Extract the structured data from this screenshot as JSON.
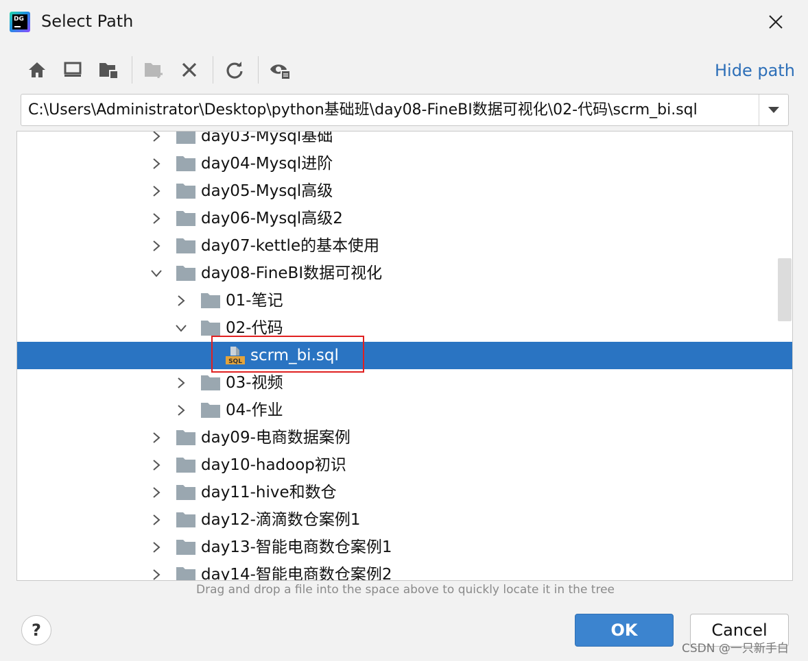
{
  "window": {
    "title": "Select Path",
    "app_icon_text": "DG"
  },
  "toolbar": {
    "hide_path_label": "Hide path",
    "buttons": [
      "home-icon",
      "desktop-icon",
      "project-folder-icon",
      "new-folder-icon",
      "delete-icon",
      "refresh-icon",
      "show-hidden-icon"
    ]
  },
  "path": {
    "value": "C:\\Users\\Administrator\\Desktop\\python基础班\\day08-FineBI数据可视化\\02-代码\\scrm_bi.sql"
  },
  "tree": {
    "rows": [
      {
        "label": "day03-Mysql基础",
        "expanded": false
      },
      {
        "label": "day04-Mysql进阶",
        "expanded": false
      },
      {
        "label": "day05-Mysql高级",
        "expanded": false
      },
      {
        "label": "day06-Mysql高级2",
        "expanded": false
      },
      {
        "label": "day07-kettle的基本使用",
        "expanded": false
      },
      {
        "label": "day08-FineBI数据可视化",
        "expanded": true
      },
      {
        "label": "01-笔记",
        "expanded": false
      },
      {
        "label": "02-代码",
        "expanded": true
      },
      {
        "label": "scrm_bi.sql",
        "selected": true
      },
      {
        "label": "03-视频",
        "expanded": false
      },
      {
        "label": "04-作业",
        "expanded": false
      },
      {
        "label": "day09-电商数据案例",
        "expanded": false
      },
      {
        "label": "day10-hadoop初识",
        "expanded": false
      },
      {
        "label": "day11-hive和数仓",
        "expanded": false
      },
      {
        "label": "day12-滴滴数仓案例1",
        "expanded": false
      },
      {
        "label": "day13-智能电商数仓案例1",
        "expanded": false
      },
      {
        "label": "day14-智能电商数仓案例2",
        "expanded": false
      }
    ],
    "file_badge": "SQL"
  },
  "hint": "Drag and drop a file into the space above to quickly locate it in the tree",
  "footer": {
    "help_label": "?",
    "ok_label": "OK",
    "cancel_label": "Cancel"
  },
  "watermark": "CSDN @一只新手白",
  "colors": {
    "selection": "#2a74c2",
    "link": "#2d6fb8",
    "ok_button": "#3c84cf",
    "highlight_box": "#e02020"
  }
}
